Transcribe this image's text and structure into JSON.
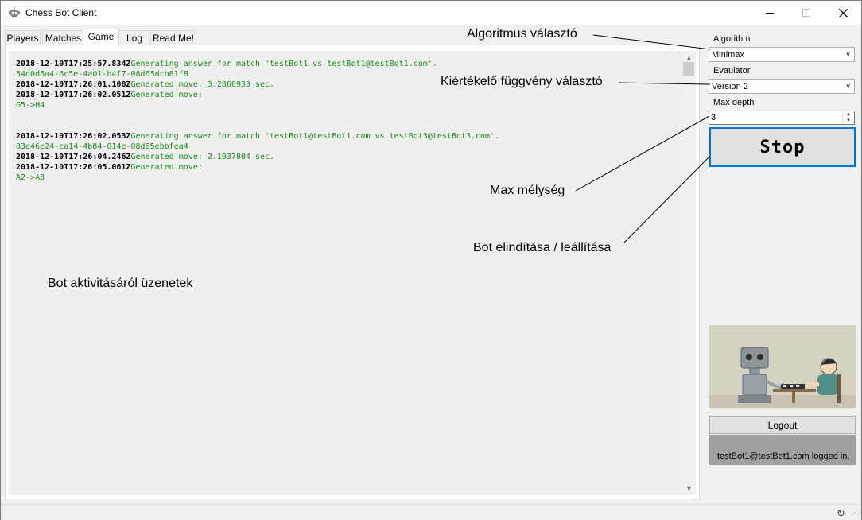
{
  "window": {
    "title": "Chess Bot Client",
    "icons": {
      "app": "robot-icon",
      "minimize": "minimize-icon",
      "maximize": "maximize-icon",
      "close": "close-icon"
    }
  },
  "tabs": [
    {
      "label": "Players",
      "active": false
    },
    {
      "label": "Matches",
      "active": false
    },
    {
      "label": "Game",
      "active": true
    },
    {
      "label": "Log",
      "active": false
    },
    {
      "label": "Read Me!",
      "active": false
    }
  ],
  "log": {
    "colors": {
      "timestamp": "#000000",
      "message": "#1a8a1a"
    },
    "lines": [
      {
        "ts": "2018-12-10T17:25:57.834Z",
        "msg": "Generating answer for match 'testBot1 vs testBot1@testBot1.com'."
      },
      {
        "ts": "",
        "msg": "54d0d6a4-6c5e-4a01-b4f7-08d65dcb81f8"
      },
      {
        "ts": "2018-12-10T17:26:01.108Z",
        "msg": "Generated move: 3.2860933 sec."
      },
      {
        "ts": "2018-12-10T17:26:02.051Z",
        "msg": "Generated move:"
      },
      {
        "ts": "",
        "msg": "G5->H4"
      },
      {
        "ts": "2018-12-10T17:26:02.053Z",
        "msg": "Generating answer for match 'testBot1@testBot1.com vs testBot3@testBot3.com'."
      },
      {
        "ts": "",
        "msg": "83e46e24-ca14-4b84-014e-08d65ebbfea4"
      },
      {
        "ts": "2018-12-10T17:26:04.246Z",
        "msg": "Generated move: 2.1937804 sec."
      },
      {
        "ts": "2018-12-10T17:26:05.061Z",
        "msg": "Generated move:"
      },
      {
        "ts": "",
        "msg": "A2->A3"
      }
    ]
  },
  "settings": {
    "algorithm_label": "Algorithm",
    "algorithm_value": "Minimax",
    "evaluator_label": "Evaulator",
    "evaluator_value": "Version 2",
    "max_depth_label": "Max depth",
    "max_depth_value": "3",
    "stop_label": "Stop"
  },
  "account": {
    "logout_label": "Logout",
    "status_text": "testBot1@testBot1.com logged in."
  },
  "annotations": {
    "algorithm": "Algoritmus választó",
    "evaluator": "Kiértékelő függvény választó",
    "max_depth": "Max mélység",
    "start_stop": "Bot elindítása / leállítása",
    "messages": "Bot aktivitásáról üzenetek"
  },
  "accent_color": "#0078d7"
}
